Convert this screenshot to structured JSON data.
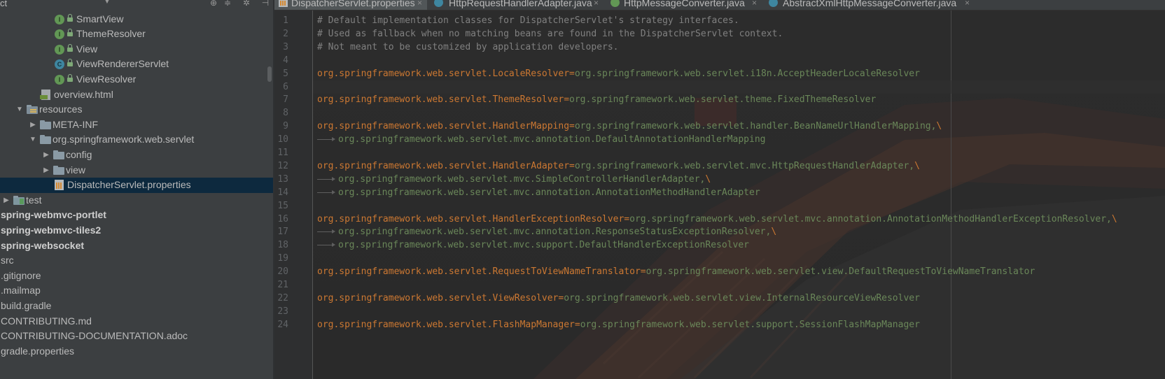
{
  "project": {
    "dropdown_label": "ct",
    "toolbar_icons": [
      "globe-icon",
      "collapse-all-icon",
      "settings-icon",
      "hide-icon"
    ],
    "tree": [
      {
        "label": "SmartView",
        "type": "interface",
        "depth": 4,
        "arrow": ""
      },
      {
        "label": "ThemeResolver",
        "type": "interface",
        "depth": 4,
        "arrow": ""
      },
      {
        "label": "View",
        "type": "interface",
        "depth": 4,
        "arrow": ""
      },
      {
        "label": "ViewRendererServlet",
        "type": "class",
        "depth": 4,
        "arrow": ""
      },
      {
        "label": "ViewResolver",
        "type": "interface",
        "depth": 4,
        "arrow": ""
      },
      {
        "label": "overview.html",
        "type": "html",
        "depth": 3,
        "arrow": ""
      },
      {
        "label": "resources",
        "type": "res-folder",
        "depth": 1,
        "arrow": "expanded"
      },
      {
        "label": "META-INF",
        "type": "folder",
        "depth": 2,
        "arrow": "collapsed"
      },
      {
        "label": "org.springframework.web.servlet",
        "type": "folder",
        "depth": 2,
        "arrow": "expanded"
      },
      {
        "label": "config",
        "type": "folder",
        "depth": 3,
        "arrow": "collapsed"
      },
      {
        "label": "view",
        "type": "folder",
        "depth": 3,
        "arrow": "collapsed"
      },
      {
        "label": "DispatcherServlet.properties",
        "type": "props",
        "depth": 4,
        "arrow": "",
        "selected": true
      },
      {
        "label": "test",
        "type": "test-folder",
        "depth": 0,
        "arrow": "collapsed"
      },
      {
        "label": "spring-webmvc-portlet",
        "type": "module",
        "depth": 0,
        "arrow": ""
      },
      {
        "label": "spring-webmvc-tiles2",
        "type": "module",
        "depth": 0,
        "arrow": ""
      },
      {
        "label": "spring-websocket",
        "type": "module",
        "depth": 0,
        "arrow": ""
      },
      {
        "label": "src",
        "type": "plain",
        "depth": 0,
        "arrow": ""
      },
      {
        "label": ".gitignore",
        "type": "plain",
        "depth": 0,
        "arrow": ""
      },
      {
        "label": ".mailmap",
        "type": "plain",
        "depth": 0,
        "arrow": ""
      },
      {
        "label": "build.gradle",
        "type": "plain",
        "depth": 0,
        "arrow": ""
      },
      {
        "label": "CONTRIBUTING.md",
        "type": "plain",
        "depth": 0,
        "arrow": ""
      },
      {
        "label": "CONTRIBUTING-DOCUMENTATION.adoc",
        "type": "plain",
        "depth": 0,
        "arrow": ""
      },
      {
        "label": "gradle.properties",
        "type": "plain",
        "depth": 0,
        "arrow": ""
      }
    ]
  },
  "tabs": [
    {
      "label": "DispatcherServlet.properties",
      "icon": "properties-file-icon",
      "active": true
    },
    {
      "label": "HttpRequestHandlerAdapter.java",
      "icon": "class-icon",
      "active": false
    },
    {
      "label": "HttpMessageConverter.java",
      "icon": "interface-icon",
      "active": false
    },
    {
      "label": "AbstractXmlHttpMessageConverter.java",
      "icon": "class-icon",
      "active": false
    }
  ],
  "tab_close_glyph": "×",
  "editor": {
    "current_line": 6,
    "lines": [
      {
        "n": "1",
        "kind": "comment",
        "text": "# Default implementation classes for DispatcherServlet's strategy interfaces."
      },
      {
        "n": "2",
        "kind": "comment",
        "text": "# Used as fallback when no matching beans are found in the DispatcherServlet context."
      },
      {
        "n": "3",
        "kind": "comment",
        "text": "# Not meant to be customized by application developers."
      },
      {
        "n": "4",
        "kind": "blank",
        "text": ""
      },
      {
        "n": "5",
        "kind": "prop",
        "key": "org.springframework.web.servlet.LocaleResolver",
        "value": "org.springframework.web.servlet.i18n.AcceptHeaderLocaleResolver",
        "cont": false
      },
      {
        "n": "6",
        "kind": "blank",
        "text": ""
      },
      {
        "n": "7",
        "kind": "prop",
        "key": "org.springframework.web.servlet.ThemeResolver",
        "value": "org.springframework.web.servlet.theme.FixedThemeResolver",
        "cont": false
      },
      {
        "n": "8",
        "kind": "blank",
        "text": ""
      },
      {
        "n": "9",
        "kind": "prop",
        "key": "org.springframework.web.servlet.HandlerMapping",
        "value": "org.springframework.web.servlet.handler.BeanNameUrlHandlerMapping,",
        "cont": true
      },
      {
        "n": "10",
        "kind": "cont",
        "value": "org.springframework.web.servlet.mvc.annotation.DefaultAnnotationHandlerMapping",
        "cont": false
      },
      {
        "n": "11",
        "kind": "blank",
        "text": ""
      },
      {
        "n": "12",
        "kind": "prop",
        "key": "org.springframework.web.servlet.HandlerAdapter",
        "value": "org.springframework.web.servlet.mvc.HttpRequestHandlerAdapter,",
        "cont": true
      },
      {
        "n": "13",
        "kind": "cont",
        "value": "org.springframework.web.servlet.mvc.SimpleControllerHandlerAdapter,",
        "cont": true
      },
      {
        "n": "14",
        "kind": "cont",
        "value": "org.springframework.web.servlet.mvc.annotation.AnnotationMethodHandlerAdapter",
        "cont": false
      },
      {
        "n": "15",
        "kind": "blank",
        "text": ""
      },
      {
        "n": "16",
        "kind": "prop",
        "key": "org.springframework.web.servlet.HandlerExceptionResolver",
        "value": "org.springframework.web.servlet.mvc.annotation.AnnotationMethodHandlerExceptionResolver,",
        "cont": true
      },
      {
        "n": "17",
        "kind": "cont",
        "value": "org.springframework.web.servlet.mvc.annotation.ResponseStatusExceptionResolver,",
        "cont": true
      },
      {
        "n": "18",
        "kind": "cont",
        "value": "org.springframework.web.servlet.mvc.support.DefaultHandlerExceptionResolver",
        "cont": false
      },
      {
        "n": "19",
        "kind": "blank",
        "text": ""
      },
      {
        "n": "20",
        "kind": "prop",
        "key": "org.springframework.web.servlet.RequestToViewNameTranslator",
        "value": "org.springframework.web.servlet.view.DefaultRequestToViewNameTranslator",
        "cont": false
      },
      {
        "n": "21",
        "kind": "blank",
        "text": ""
      },
      {
        "n": "22",
        "kind": "prop",
        "key": "org.springframework.web.servlet.ViewResolver",
        "value": "org.springframework.web.servlet.view.InternalResourceViewResolver",
        "cont": false
      },
      {
        "n": "23",
        "kind": "blank",
        "text": ""
      },
      {
        "n": "24",
        "kind": "prop",
        "key": "org.springframework.web.servlet.FlashMapManager",
        "value": "org.springframework.web.servlet.support.SessionFlashMapManager",
        "cont": false
      }
    ]
  },
  "colors": {
    "comment": "#808080",
    "key": "#cc7832",
    "value": "#6a8759",
    "line_number": "#606366",
    "selection": "#0d293e",
    "tree_text": "#bbbbbb"
  }
}
